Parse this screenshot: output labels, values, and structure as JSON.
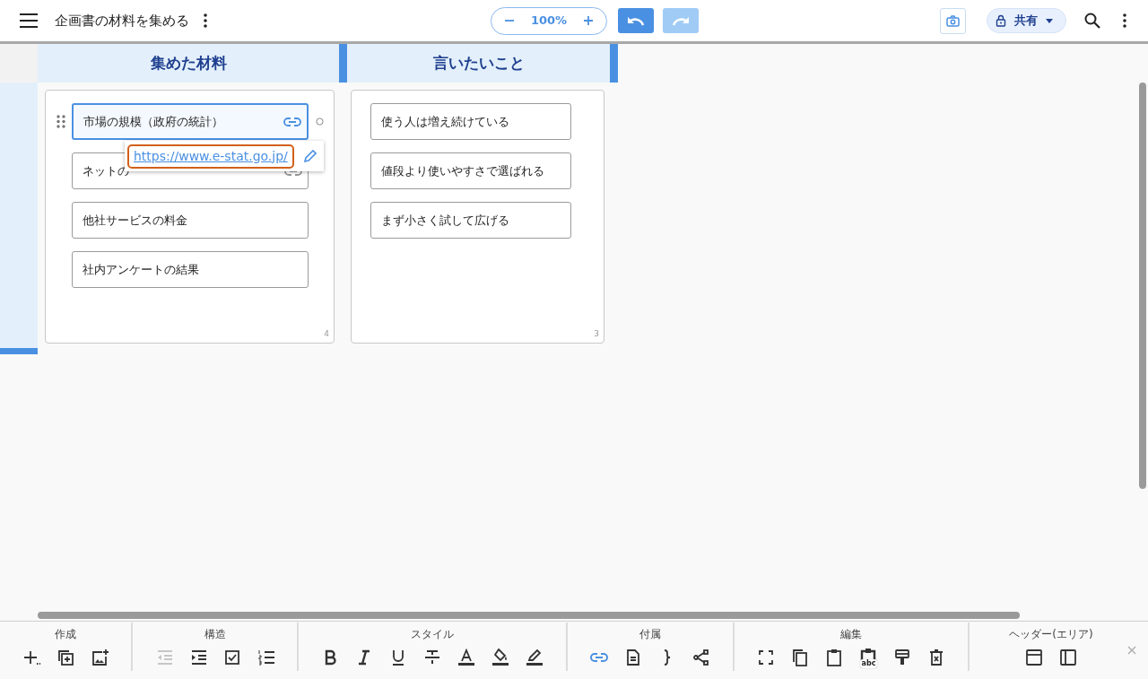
{
  "header": {
    "title": "企画書の材料を集める",
    "zoom": "100%",
    "undo": {
      "disabled": false
    },
    "redo": {
      "disabled": true
    },
    "share": "共有"
  },
  "columns": [
    {
      "title": "集めた材料",
      "count": "4",
      "cards": [
        {
          "text": "市場の規模（政府の統計）",
          "selected": true,
          "link": true
        },
        {
          "text": "ネットの",
          "selected": false,
          "link": true
        },
        {
          "text": "他社サービスの料金",
          "selected": false,
          "link": false
        },
        {
          "text": "社内アンケートの結果",
          "selected": false,
          "link": false
        }
      ]
    },
    {
      "title": "言いたいこと",
      "count": "3",
      "cards": [
        {
          "text": "使う人は増え続けている",
          "selected": false,
          "link": false
        },
        {
          "text": "値段より使いやすさで選ばれる",
          "selected": false,
          "link": false
        },
        {
          "text": "まず小さく試して広げる",
          "selected": false,
          "link": false
        }
      ]
    }
  ],
  "link_popup": {
    "url": "https://www.e-stat.go.jp/"
  },
  "toolbar": [
    {
      "label": "作成",
      "tools": [
        {
          "kind": "add",
          "disabled": false,
          "on": false
        },
        {
          "kind": "duplicate",
          "disabled": false,
          "on": false
        },
        {
          "kind": "image",
          "disabled": false,
          "on": false
        }
      ]
    },
    {
      "label": "構造",
      "tools": [
        {
          "kind": "outdent",
          "disabled": true,
          "on": false
        },
        {
          "kind": "indent",
          "disabled": false,
          "on": false
        },
        {
          "kind": "checkbox",
          "disabled": false,
          "on": false
        },
        {
          "kind": "numbered",
          "disabled": false,
          "on": false
        }
      ]
    },
    {
      "label": "スタイル",
      "tools": [
        {
          "kind": "bold",
          "disabled": false,
          "on": false
        },
        {
          "kind": "italic",
          "disabled": false,
          "on": false
        },
        {
          "kind": "underline",
          "disabled": false,
          "on": false
        },
        {
          "kind": "strike",
          "disabled": false,
          "on": false
        },
        {
          "kind": "textcolor",
          "disabled": false,
          "on": false
        },
        {
          "kind": "fill",
          "disabled": false,
          "on": false
        },
        {
          "kind": "pen",
          "disabled": false,
          "on": false
        }
      ]
    },
    {
      "label": "付属",
      "tools": [
        {
          "kind": "link",
          "disabled": false,
          "on": true
        },
        {
          "kind": "note",
          "disabled": false,
          "on": false
        },
        {
          "kind": "brace",
          "disabled": false,
          "on": false
        },
        {
          "kind": "share",
          "disabled": false,
          "on": false
        }
      ]
    },
    {
      "label": "編集",
      "tools": [
        {
          "kind": "select",
          "disabled": false,
          "on": false
        },
        {
          "kind": "copy",
          "disabled": false,
          "on": false
        },
        {
          "kind": "paste",
          "disabled": false,
          "on": false
        },
        {
          "kind": "pastetext",
          "disabled": false,
          "on": false,
          "badge": "abc"
        },
        {
          "kind": "format",
          "disabled": false,
          "on": false
        },
        {
          "kind": "delete",
          "disabled": false,
          "on": false
        }
      ]
    },
    {
      "label": "ヘッダー(エリア)",
      "tools": [
        {
          "kind": "topheader",
          "disabled": false,
          "on": false
        },
        {
          "kind": "sideheader",
          "disabled": false,
          "on": false
        }
      ]
    }
  ]
}
